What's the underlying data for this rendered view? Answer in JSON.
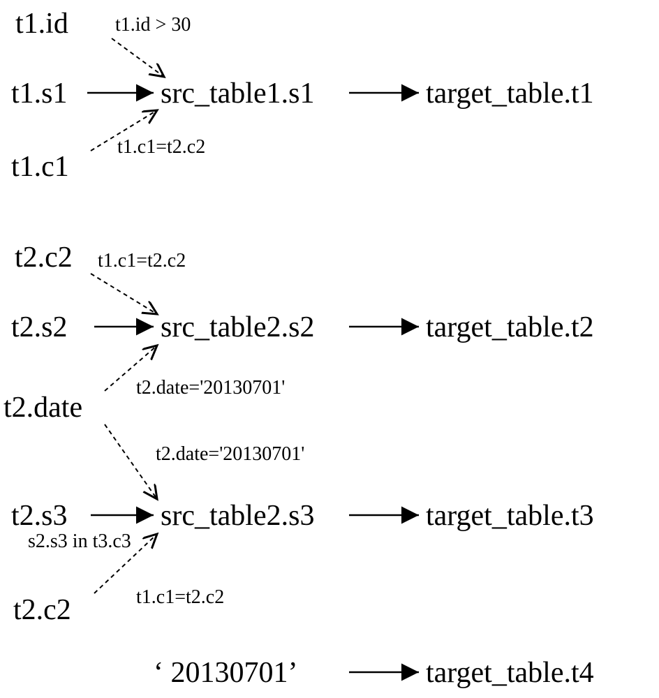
{
  "nodes": {
    "t1_id": "t1.id",
    "t1_s1": "t1.s1",
    "t1_c1": "t1.c1",
    "src_table1_s1": "src_table1.s1",
    "target_table_t1": "target_table.t1",
    "t2_c2_a": "t2.c2",
    "t2_s2": "t2.s2",
    "t2_date": "t2.date",
    "src_table2_s2": "src_table2.s2",
    "target_table_t2": "target_table.t2",
    "t2_s3": "t2.s3",
    "t2_c2_b": "t2.c2",
    "src_table2_s3": "src_table2.s3",
    "target_table_t3": "target_table.t3",
    "literal_date": "‘ 20130701’",
    "target_table_t4": "target_table.t4"
  },
  "annotations": {
    "t1_id_cond": "t1.id > 30",
    "t1c1_t2c2_a": "t1.c1=t2.c2",
    "t1c1_t2c2_b": "t1.c1=t2.c2",
    "t2_date_cond_a": "t2.date='20130701'",
    "t2_date_cond_b": "t2.date='20130701'",
    "s2s3_in_t3c3": "s2.s3 in t3.c3",
    "t1c1_t2c2_c": "t1.c1=t2.c2"
  }
}
